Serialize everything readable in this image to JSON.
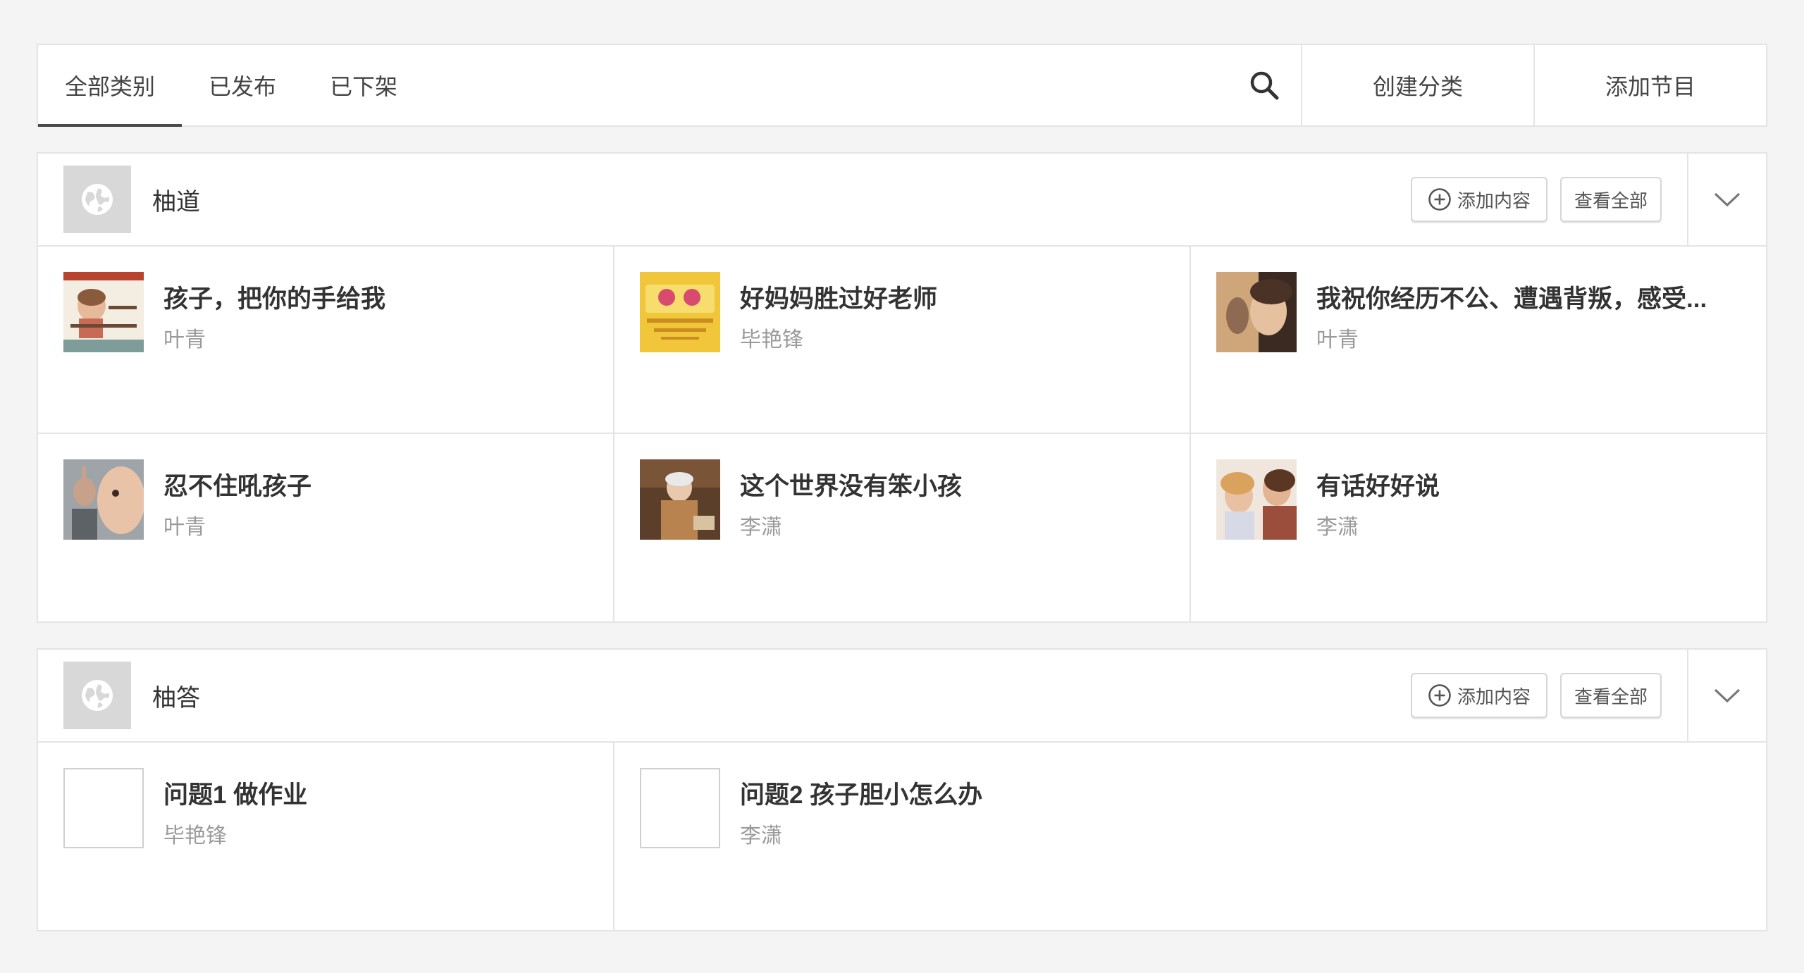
{
  "tabs": [
    "全部类别",
    "已发布",
    "已下架"
  ],
  "toolbar": {
    "search_icon": "search-icon",
    "create_category": "创建分类",
    "add_program": "添加节目"
  },
  "sections": [
    {
      "title": "柚道",
      "add_content": "添加内容",
      "view_all": "查看全部",
      "items": [
        {
          "title": "孩子，把你的手给我",
          "author": "叶青"
        },
        {
          "title": "好妈妈胜过好老师",
          "author": "毕艳锋"
        },
        {
          "title": "我祝你经历不公、遭遇背叛，感受...",
          "author": "叶青"
        },
        {
          "title": "忍不住吼孩子",
          "author": "叶青"
        },
        {
          "title": "这个世界没有笨小孩",
          "author": "李潇"
        },
        {
          "title": "有话好好说",
          "author": "李潇"
        }
      ]
    },
    {
      "title": "柚答",
      "add_content": "添加内容",
      "view_all": "查看全部",
      "items": [
        {
          "title": "问题1 做作业",
          "author": "毕艳锋"
        },
        {
          "title": "问题2 孩子胆小怎么办",
          "author": "李潇"
        }
      ]
    }
  ],
  "colors": {
    "background": "#f4f4f5",
    "border": "#e4e4e6",
    "active_tab_underline": "#4a4a4a",
    "muted_text": "#9a9a9a"
  }
}
